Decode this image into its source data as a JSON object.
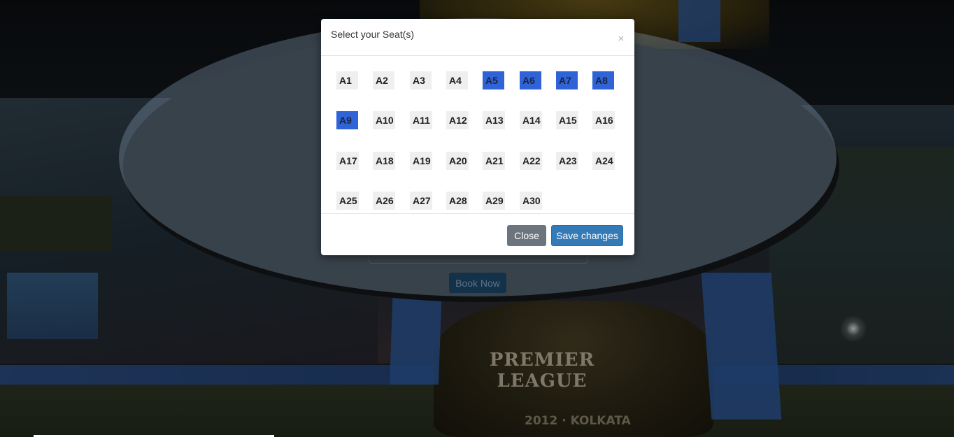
{
  "background": {
    "trophy_text": "PREMIER LEAGUE",
    "trophy_year_text": "2012 · KOLKATA"
  },
  "booking": {
    "book_now_label": "Book Now"
  },
  "modal": {
    "title": "Select your Seat(s)",
    "close_icon": "×",
    "seats": [
      {
        "label": "A1",
        "selected": false
      },
      {
        "label": "A2",
        "selected": false
      },
      {
        "label": "A3",
        "selected": false
      },
      {
        "label": "A4",
        "selected": false
      },
      {
        "label": "A5",
        "selected": true
      },
      {
        "label": "A6",
        "selected": true
      },
      {
        "label": "A7",
        "selected": true
      },
      {
        "label": "A8",
        "selected": true
      },
      {
        "label": "A9",
        "selected": true
      },
      {
        "label": "A10",
        "selected": false
      },
      {
        "label": "A11",
        "selected": false
      },
      {
        "label": "A12",
        "selected": false
      },
      {
        "label": "A13",
        "selected": false
      },
      {
        "label": "A14",
        "selected": false
      },
      {
        "label": "A15",
        "selected": false
      },
      {
        "label": "A16",
        "selected": false
      },
      {
        "label": "A17",
        "selected": false
      },
      {
        "label": "A18",
        "selected": false
      },
      {
        "label": "A19",
        "selected": false
      },
      {
        "label": "A20",
        "selected": false
      },
      {
        "label": "A21",
        "selected": false
      },
      {
        "label": "A22",
        "selected": false
      },
      {
        "label": "A23",
        "selected": false
      },
      {
        "label": "A24",
        "selected": false
      },
      {
        "label": "A25",
        "selected": false
      },
      {
        "label": "A26",
        "selected": false
      },
      {
        "label": "A27",
        "selected": false
      },
      {
        "label": "A28",
        "selected": false
      },
      {
        "label": "A29",
        "selected": false
      },
      {
        "label": "A30",
        "selected": false
      }
    ],
    "footer": {
      "close_label": "Close",
      "save_label": "Save changes"
    }
  },
  "colors": {
    "seat_selected": "#2f63d6",
    "seat_default": "#efefef",
    "primary_button": "#337ab7",
    "secondary_button": "#6c757d"
  }
}
